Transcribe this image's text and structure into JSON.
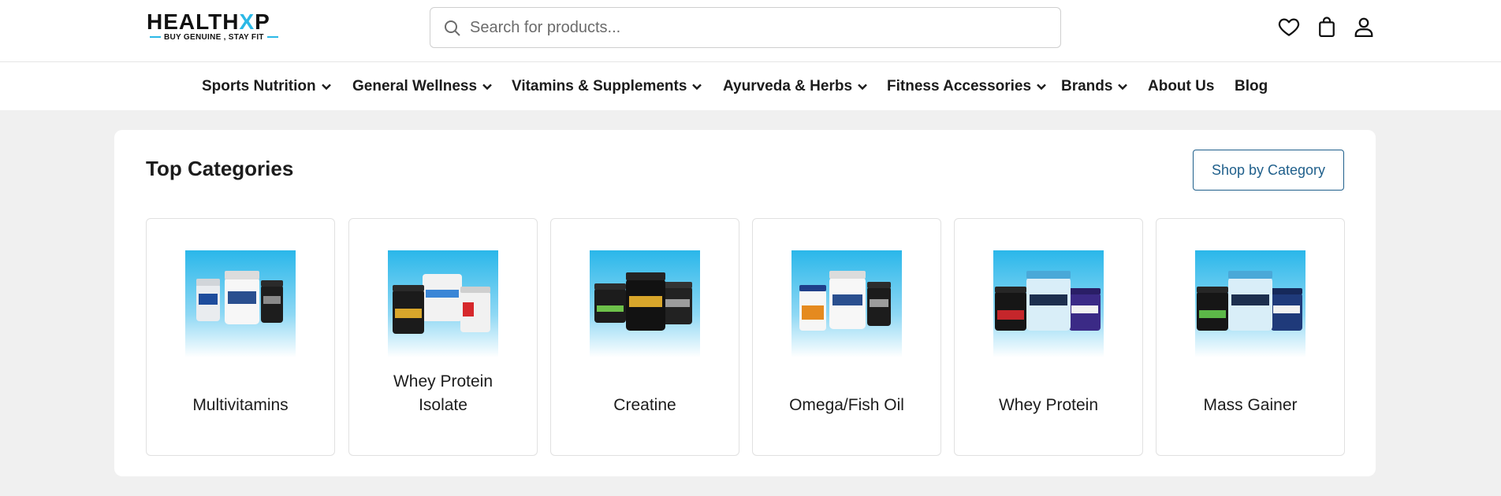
{
  "brand": {
    "name_prefix": "HEALTH",
    "name_x": "X",
    "name_suffix": "P",
    "tagline": "BUY GENUINE , STAY FIT",
    "accent_color": "#2bb8e6"
  },
  "search": {
    "placeholder": "Search for products...",
    "value": ""
  },
  "header_icons": [
    "heart-icon",
    "shopping-bag-icon",
    "user-icon"
  ],
  "nav": {
    "items": [
      {
        "label": "Sports Nutrition",
        "dropdown": true
      },
      {
        "label": "General Wellness",
        "dropdown": true
      },
      {
        "label": "Vitamins & Supplements",
        "dropdown": true
      },
      {
        "label": "Ayurveda & Herbs",
        "dropdown": true
      },
      {
        "label": "Fitness Accessories",
        "dropdown": true
      },
      {
        "label": "Brands",
        "dropdown": true
      },
      {
        "label": "About Us",
        "dropdown": false
      },
      {
        "label": "Blog",
        "dropdown": false
      }
    ]
  },
  "top_categories": {
    "title": "Top Categories",
    "button_label": "Shop by Category",
    "button_color": "#1f5f8b",
    "items": [
      {
        "label_line1": "Multivitamins",
        "label_line2": ""
      },
      {
        "label_line1": "Whey Protein",
        "label_line2": "Isolate"
      },
      {
        "label_line1": "Creatine",
        "label_line2": ""
      },
      {
        "label_line1": "Omega/Fish Oil",
        "label_line2": ""
      },
      {
        "label_line1": "Whey Protein",
        "label_line2": ""
      },
      {
        "label_line1": "Mass Gainer",
        "label_line2": ""
      }
    ]
  }
}
